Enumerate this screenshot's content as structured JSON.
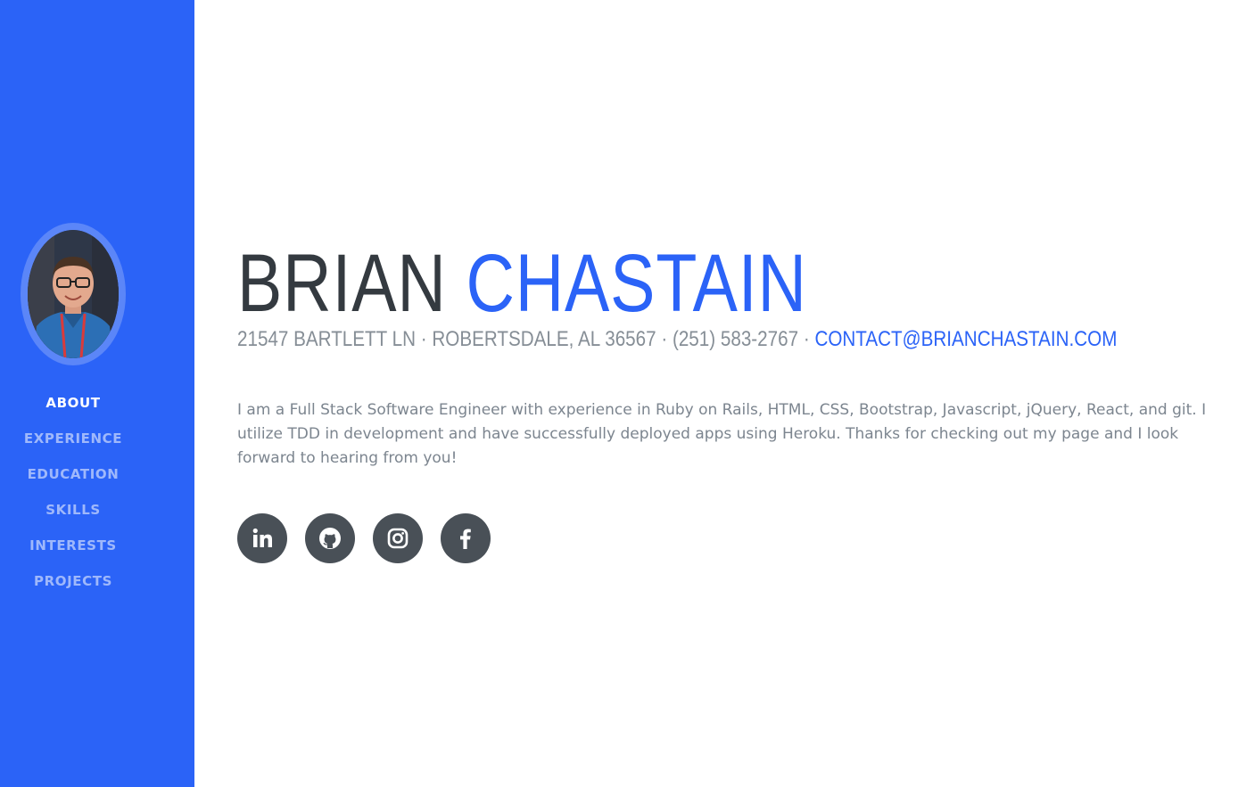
{
  "colors": {
    "primary": "#2b63f7",
    "dark": "#343a40",
    "muted": "#868e96",
    "social_bg": "#495057"
  },
  "sidebar": {
    "avatar_alt": "Profile photo",
    "nav": [
      {
        "label": "ABOUT",
        "active": true
      },
      {
        "label": "EXPERIENCE",
        "active": false
      },
      {
        "label": "EDUCATION",
        "active": false
      },
      {
        "label": "SKILLS",
        "active": false
      },
      {
        "label": "INTERESTS",
        "active": false
      },
      {
        "label": "PROJECTS",
        "active": false
      }
    ]
  },
  "about": {
    "first_name": "BRIAN",
    "last_name": "CHASTAIN",
    "address": "21547 BARTLETT LN · ROBERTSDALE, AL 36567 · (251) 583-2767 · ",
    "email": "CONTACT@BRIANCHASTAIN.COM",
    "bio": "I am a Full Stack Software Engineer with experience in Ruby on Rails, HTML, CSS, Bootstrap, Javascript, jQuery, React, and git. I utilize TDD in development and have successfully deployed apps using Heroku. Thanks for checking out my page and I look forward to hearing from you!"
  },
  "social": [
    {
      "icon": "linkedin-icon"
    },
    {
      "icon": "github-icon"
    },
    {
      "icon": "instagram-icon"
    },
    {
      "icon": "facebook-icon"
    }
  ]
}
